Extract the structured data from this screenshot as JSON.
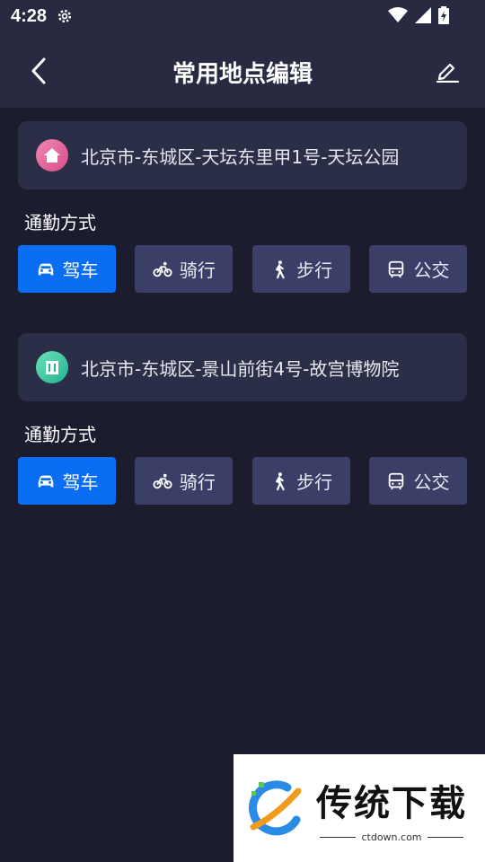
{
  "status": {
    "time": "4:28"
  },
  "header": {
    "title": "常用地点编辑"
  },
  "places": [
    {
      "address": "北京市-东城区-天坛东里甲1号-天坛公园",
      "icon": "home-icon",
      "icon_color": "#e75a8f",
      "commute_label": "通勤方式",
      "modes": [
        {
          "label": "驾车",
          "icon": "car-icon",
          "active": true
        },
        {
          "label": "骑行",
          "icon": "bike-icon",
          "active": false
        },
        {
          "label": "步行",
          "icon": "walk-icon",
          "active": false
        },
        {
          "label": "公交",
          "icon": "bus-icon",
          "active": false
        }
      ]
    },
    {
      "address": "北京市-东城区-景山前街4号-故宫博物院",
      "icon": "building-icon",
      "icon_color": "#2fc7a1",
      "commute_label": "通勤方式",
      "modes": [
        {
          "label": "驾车",
          "icon": "car-icon",
          "active": true
        },
        {
          "label": "骑行",
          "icon": "bike-icon",
          "active": false
        },
        {
          "label": "步行",
          "icon": "walk-icon",
          "active": false
        },
        {
          "label": "公交",
          "icon": "bus-icon",
          "active": false
        }
      ]
    }
  ],
  "watermark": {
    "title": "传统下载",
    "sub": "ctdown.com"
  },
  "colors": {
    "background": "#1b1d2e",
    "header": "#272a41",
    "card": "#2b2e47",
    "mode_inactive": "#3b3f67",
    "mode_active": "#0a6ef5"
  }
}
